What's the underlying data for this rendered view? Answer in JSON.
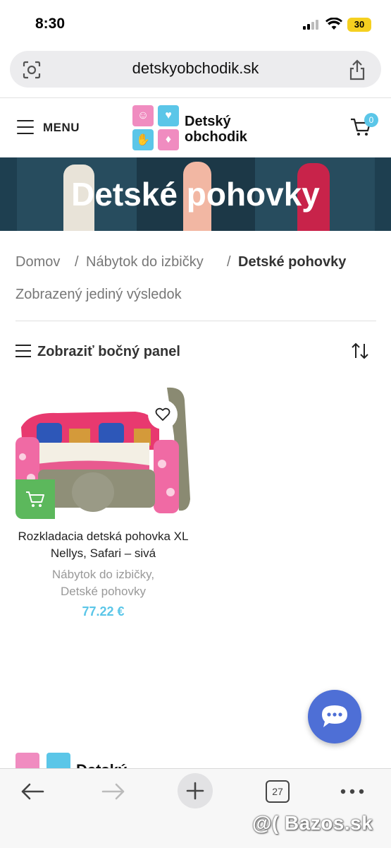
{
  "status_bar": {
    "time": "8:30",
    "battery": "30"
  },
  "browser": {
    "url": "detskyobchodik.sk",
    "tab_count": "27"
  },
  "header": {
    "menu_label": "MENU",
    "logo_line1": "Detský",
    "logo_line2": "obchodik",
    "cart_count": "0"
  },
  "hero": {
    "title": "Detské pohovky"
  },
  "breadcrumb": {
    "home": "Domov",
    "separator": "/",
    "parent": "Nábytok do izbičky",
    "current": "Detské pohovky"
  },
  "results": {
    "text": "Zobrazený jediný výsledok"
  },
  "sidebar_toggle": {
    "label": "Zobraziť bočný panel"
  },
  "product": {
    "title_line1": "Rozkladacia detská pohovka XL",
    "title_line2": "Nellys, Safari – sivá",
    "category_line1": "Nábytok do izbičky,",
    "category_line2": "Detské pohovky",
    "price": "77.22 €"
  },
  "footer": {
    "logo_text": "Detský"
  },
  "watermark": "@( Bazos.sk",
  "colors": {
    "accent": "#5bc6e8",
    "logo_pink": "#f08cc0",
    "logo_blue": "#5bc6e8",
    "add_to_cart": "#5cb85c",
    "chat": "#4e6fd6",
    "hero_bg": "#1e3f50"
  }
}
